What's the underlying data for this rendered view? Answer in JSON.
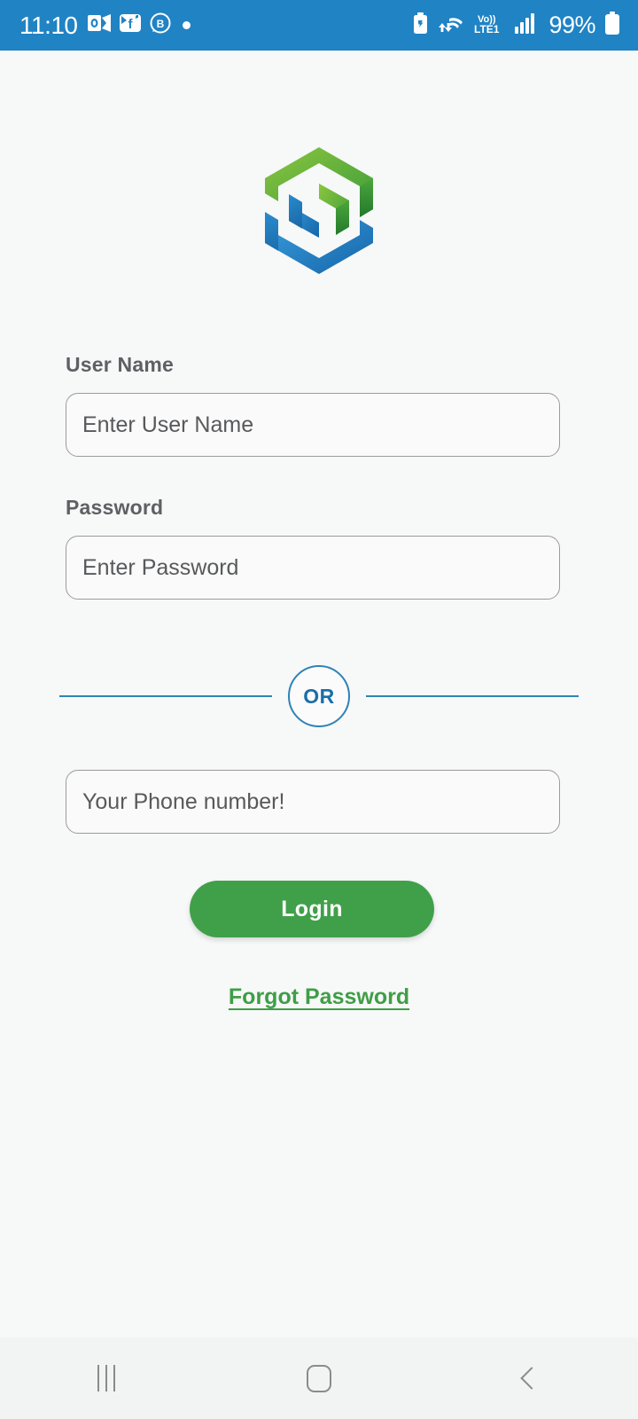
{
  "status_bar": {
    "background_color": "#2083c4",
    "time": "11:10",
    "left_icons": [
      {
        "name": "outlook-icon",
        "label": "Outlook"
      },
      {
        "name": "messenger-icon",
        "label": "Messenger"
      },
      {
        "name": "whatsapp-business-icon",
        "label": "B"
      },
      {
        "name": "notification-dot-icon",
        "label": "•"
      }
    ],
    "right_icons": [
      {
        "name": "battery-saver-icon",
        "label": "Battery saver"
      },
      {
        "name": "wifi-data-transfer-icon",
        "label": "Wi-Fi"
      },
      {
        "name": "volte-lte1-icon",
        "label": "Vo)) LTE1"
      },
      {
        "name": "signal-bars-icon",
        "label": "Signal"
      }
    ],
    "battery_percent": "99%"
  },
  "logo": {
    "name": "app-logo",
    "green_color": "#6eb43f",
    "blue_color": "#1b79c0"
  },
  "form": {
    "username": {
      "label": "User Name",
      "placeholder": "Enter User Name",
      "value": ""
    },
    "password": {
      "label": "Password",
      "placeholder": "Enter Password",
      "value": ""
    },
    "divider": {
      "text": "OR",
      "color": "#2f83b5"
    },
    "phone": {
      "placeholder": "Your Phone number!",
      "value": ""
    },
    "login_button": {
      "label": "Login",
      "color": "#40a049"
    },
    "forgot_link": {
      "label": "Forgot Password",
      "color": "#3f9e46"
    }
  },
  "nav_bar": {
    "background_color": "#f2f3f3",
    "buttons": [
      {
        "name": "recents-button",
        "label": "Recents"
      },
      {
        "name": "home-button",
        "label": "Home"
      },
      {
        "name": "back-button",
        "label": "Back"
      }
    ]
  }
}
